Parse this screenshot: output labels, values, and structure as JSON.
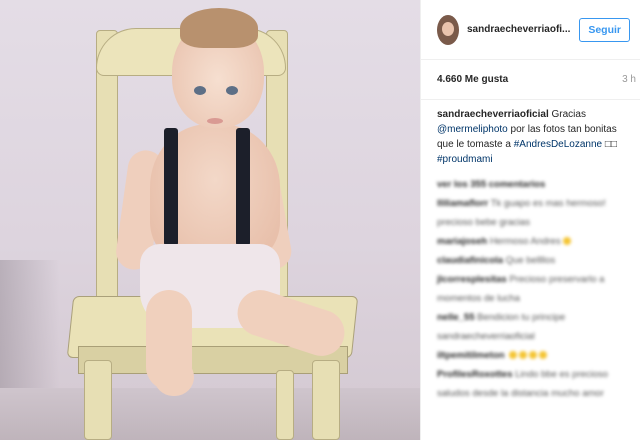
{
  "post": {
    "username": "sandraecheverriaoficial",
    "username_short": "sandraecheverriaofi...",
    "follow_label": "Seguir",
    "likes": "4.660 Me gusta",
    "time_ago": "3 h",
    "caption": {
      "author": "sandraecheverriaoficial",
      "text1": "Gracias",
      "mention": "@mermeliphoto",
      "text2": "por las fotos tan bonitas que le tomaste a",
      "hashtag1": "#AndresDeLozanne",
      "emoji": "□□",
      "hashtag2": "#proudmami"
    },
    "comments_blurred": [
      {
        "user": "ver los 355 comentarios",
        "text": ""
      },
      {
        "user": "lliliamaflorr",
        "text": "Tk guapo es mas hermoso!"
      },
      {
        "user": "",
        "text": "precioso bebe gracias"
      },
      {
        "user": "mariajoseh",
        "text": "Hermoso Andres"
      },
      {
        "user": "claudiafinicola",
        "text": "Que bellllos"
      },
      {
        "user": "",
        "text": ""
      },
      {
        "user": "jlcorresplesitas",
        "text": "Precioso preservarlo a"
      },
      {
        "user": "",
        "text": "momentos de lucha"
      },
      {
        "user": "nelle_55",
        "text": "Bendicion tu principe"
      },
      {
        "user": "",
        "text": "sandraecheverriaoficial"
      },
      {
        "user": "iltpemitilmeton",
        "text": ""
      },
      {
        "user": "ProfilesRoxottes",
        "text": "Lindo bbe es precioso"
      },
      {
        "user": "",
        "text": "saludos desde la distancia mucho amor"
      }
    ]
  },
  "colors": {
    "accent": "#3897f0",
    "link": "#003569",
    "text": "#262626",
    "muted": "#999999"
  },
  "icons": {
    "avatar": "profile-avatar"
  }
}
